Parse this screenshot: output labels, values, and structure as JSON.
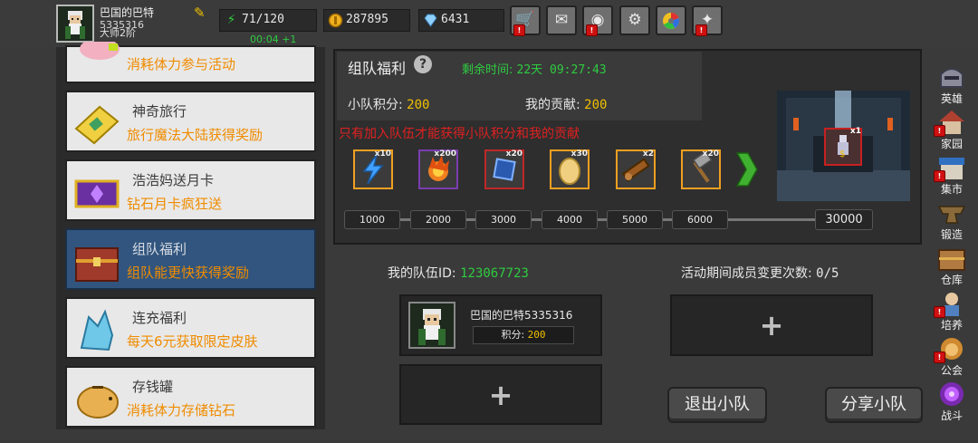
{
  "player": {
    "name": "巴国的巴特",
    "id": "5335316",
    "rank": "大师2阶"
  },
  "resources": {
    "stamina": "71/120",
    "stamina_timer": "00:04 +1",
    "gold": "287895",
    "diamond": "6431"
  },
  "topbar_icons": [
    "shop-cart-icon",
    "mail-icon",
    "gamepad-icon",
    "gear-icon",
    "color-wheel-icon",
    "broom-icon"
  ],
  "menu": [
    {
      "title": "",
      "sub": "消耗体力参与活动"
    },
    {
      "title": "神奇旅行",
      "sub": "旅行魔法大陆获得奖励"
    },
    {
      "title": "浩浩妈送月卡",
      "sub": "钻石月卡疯狂送"
    },
    {
      "title": "组队福利",
      "sub": "组队能更快获得奖励"
    },
    {
      "title": "连充福利",
      "sub": "每天6元获取限定皮肤"
    },
    {
      "title": "存钱罐",
      "sub": "消耗体力存储钻石"
    }
  ],
  "panel": {
    "title": "组队福利",
    "help": "?",
    "remaining_label": "剩余时间:",
    "remaining_value": "22天 09:27:43",
    "team_score_label": "小队积分:",
    "team_score_value": "200",
    "my_contrib_label": "我的贡献:",
    "my_contrib_value": "200",
    "notice": "只有加入队伍才能获得小队积分和我的贡献"
  },
  "rewards": [
    {
      "qty": "x10",
      "icon": "lightning-icon",
      "color": "#f0a020"
    },
    {
      "qty": "x200",
      "icon": "fire-orb-icon",
      "color": "#7a3db0"
    },
    {
      "qty": "x20",
      "icon": "blue-gem-icon",
      "color": "#c02828"
    },
    {
      "qty": "x30",
      "icon": "egg-icon",
      "color": "#f0a020"
    },
    {
      "qty": "x2",
      "icon": "cannon-icon",
      "color": "#f0a020"
    },
    {
      "qty": "x20",
      "icon": "hammer-icon",
      "color": "#f0a020"
    }
  ],
  "milestones": [
    "1000",
    "2000",
    "3000",
    "4000",
    "5000",
    "6000"
  ],
  "final_milestone": "30000",
  "final_reward_qty": "x1",
  "team": {
    "id_label": "我的队伍ID:",
    "id_value": "123067723",
    "changes_label": "活动期间成员变更次数:",
    "changes_value": "0/5",
    "member_name": "巴国的巴特5335316",
    "member_score_label": "积分:",
    "member_score_value": "200",
    "leave_button": "退出小队",
    "share_button": "分享小队"
  },
  "right_nav": [
    {
      "label": "英雄",
      "badge": false
    },
    {
      "label": "家园",
      "badge": true
    },
    {
      "label": "集市",
      "badge": true
    },
    {
      "label": "锻造",
      "badge": false
    },
    {
      "label": "仓库",
      "badge": false
    },
    {
      "label": "培养",
      "badge": true
    },
    {
      "label": "公会",
      "badge": true
    },
    {
      "label": "战斗",
      "badge": false
    }
  ]
}
